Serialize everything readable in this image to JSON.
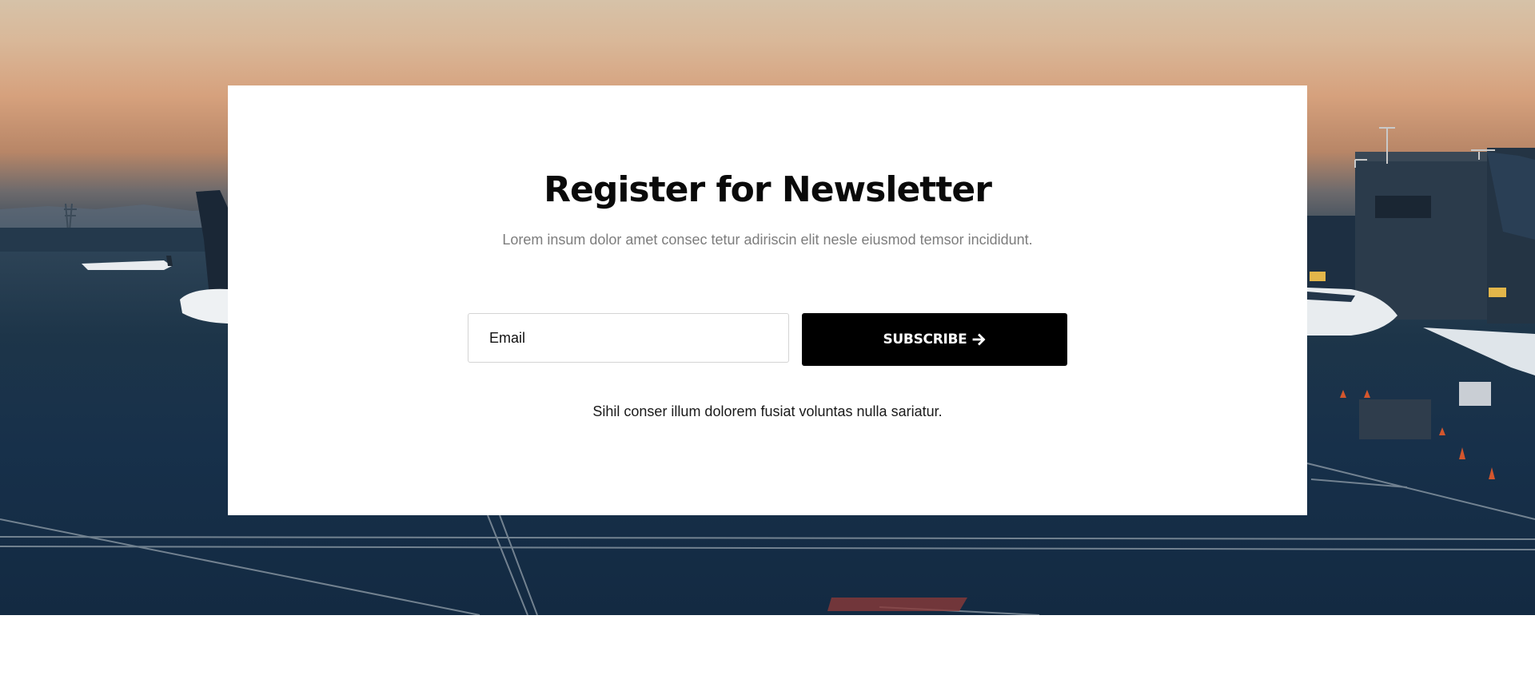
{
  "newsletter": {
    "title": "Register for Newsletter",
    "subtitle": "Lorem insum dolor amet consec tetur adiriscin elit nesle eiusmod temsor incididunt.",
    "email_placeholder": "Email",
    "subscribe_label": "SUBSCRIBE",
    "note": "Sihil conser illum dolorem fusiat voluntas nulla sariatur."
  },
  "icons": {
    "subscribe": "arrow-right-icon"
  },
  "colors": {
    "button_bg": "#000000",
    "button_text": "#ffffff",
    "title": "#0a0a0a",
    "subtitle": "#7d7d7d",
    "card_bg": "#ffffff"
  }
}
